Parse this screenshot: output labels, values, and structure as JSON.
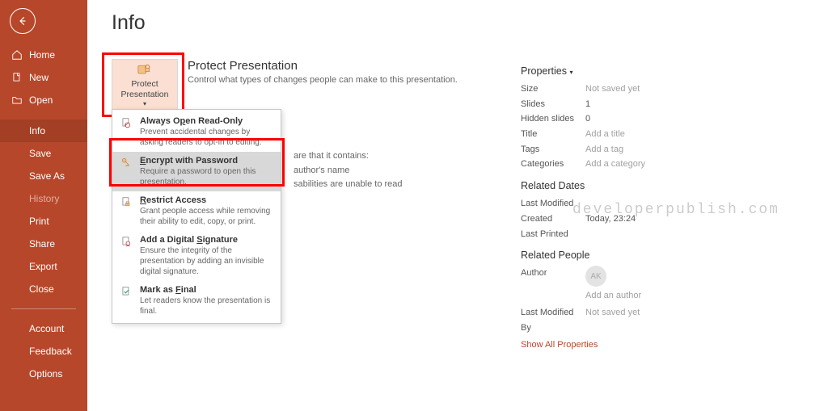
{
  "sidebar": {
    "items": [
      {
        "icon": "home",
        "label": "Home"
      },
      {
        "icon": "doc",
        "label": "New"
      },
      {
        "icon": "folder",
        "label": "Open"
      }
    ],
    "items2": [
      {
        "label": "Info",
        "active": true
      },
      {
        "label": "Save"
      },
      {
        "label": "Save As"
      },
      {
        "label": "History",
        "muted": true
      },
      {
        "label": "Print"
      },
      {
        "label": "Share"
      },
      {
        "label": "Export"
      },
      {
        "label": "Close"
      }
    ],
    "items3": [
      {
        "label": "Account"
      },
      {
        "label": "Feedback"
      },
      {
        "label": "Options"
      }
    ]
  },
  "page_title": "Info",
  "protect": {
    "button_label": "Protect Presentation",
    "heading": "Protect Presentation",
    "desc": "Control what types of changes people can make to this presentation.",
    "behind_lines": [
      "are that it contains:",
      "author's name",
      "sabilities are unable to read"
    ],
    "menu": [
      {
        "title": "Always Open Read-Only",
        "u": 8,
        "desc": "Prevent accidental changes by asking readers to opt-in to editing.",
        "icon": "doc-check"
      },
      {
        "title": "Encrypt with Password",
        "u": 0,
        "desc": "Require a password to open this presentation.",
        "icon": "key",
        "sel": true
      },
      {
        "title": "Restrict Access",
        "u": 0,
        "desc": "Grant people access while removing their ability to edit, copy, or print.",
        "icon": "doc-lock"
      },
      {
        "title": "Add a Digital Signature",
        "u": 14,
        "desc": "Ensure the integrity of the presentation by adding an invisible digital signature.",
        "icon": "doc-ribbon"
      },
      {
        "title": "Mark as Final",
        "u": 8,
        "desc": "Let readers know the presentation is final.",
        "icon": "doc-final"
      }
    ]
  },
  "properties": {
    "heading": "Properties",
    "rows": [
      {
        "k": "Size",
        "v": "Not saved yet",
        "muted": true
      },
      {
        "k": "Slides",
        "v": "1"
      },
      {
        "k": "Hidden slides",
        "v": "0"
      },
      {
        "k": "Title",
        "v": "Add a title",
        "muted": true
      },
      {
        "k": "Tags",
        "v": "Add a tag",
        "muted": true
      },
      {
        "k": "Categories",
        "v": "Add a category",
        "muted": true
      }
    ],
    "dates_heading": "Related Dates",
    "dates": [
      {
        "k": "Last Modified",
        "v": ""
      },
      {
        "k": "Created",
        "v": "Today, 23:24"
      },
      {
        "k": "Last Printed",
        "v": ""
      }
    ],
    "people_heading": "Related People",
    "author_label": "Author",
    "author_initials": "AK",
    "add_author": "Add an author",
    "modified_by_label": "Last Modified By",
    "modified_by_value": "Not saved yet",
    "show_all": "Show All Properties"
  },
  "watermark": "developerpublish.com"
}
